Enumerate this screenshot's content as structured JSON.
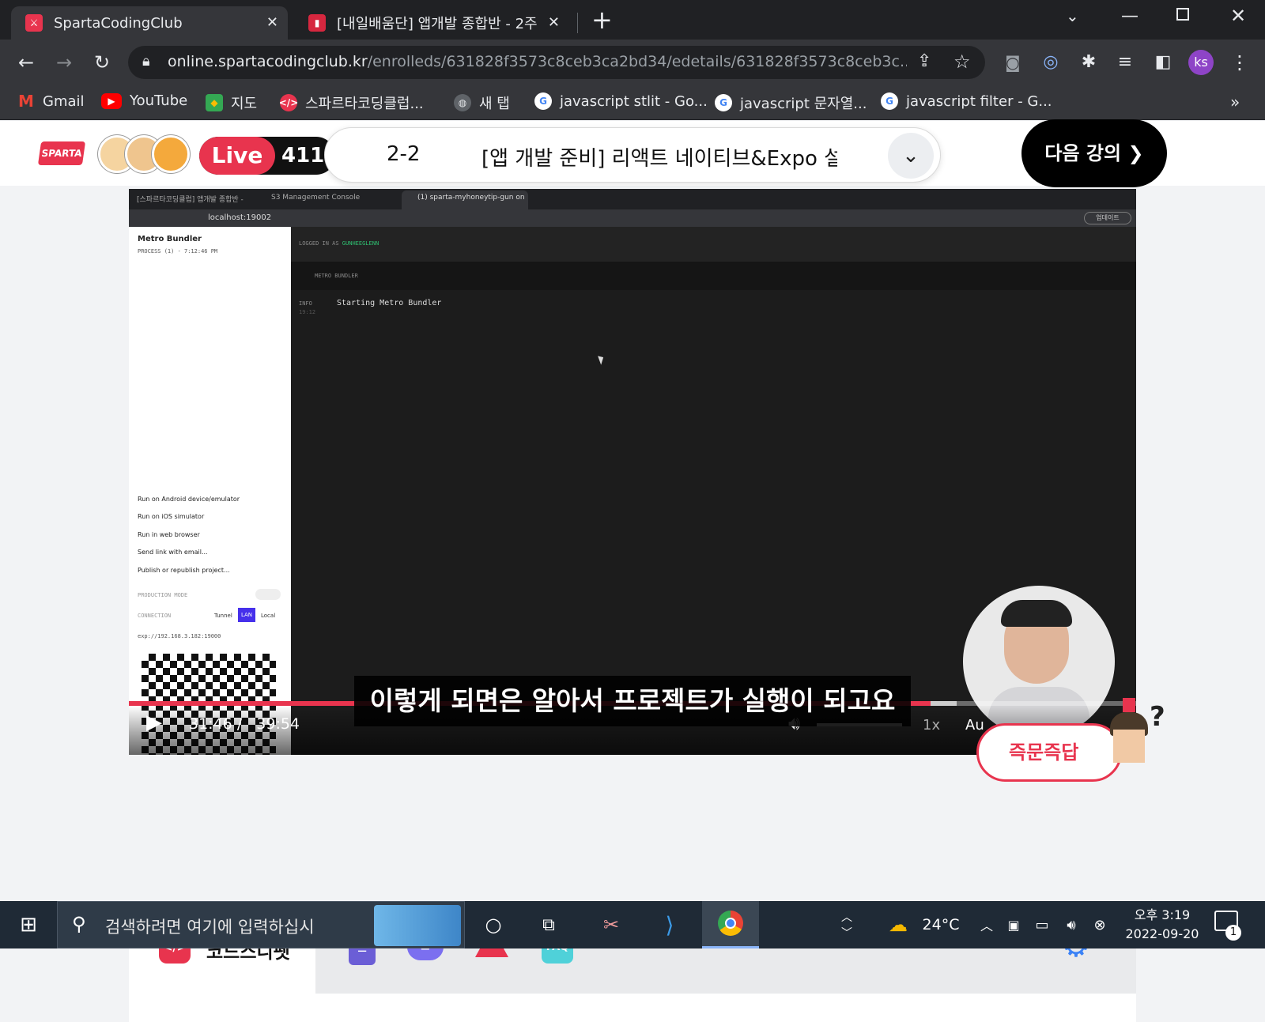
{
  "browser": {
    "tabs": [
      {
        "title": "SpartaCodingClub",
        "active": true
      },
      {
        "title": "[내일배움단] 앱개발 종합반 - 2주",
        "active": false
      }
    ],
    "url_host": "online.spartacodingclub.kr",
    "url_path": "/enrolleds/631828f3573c8ceb3ca2bd34/edetails/631828f3573c8ceb3c...",
    "profile_initials": "ks",
    "bookmarks": [
      {
        "label": "Gmail",
        "icon": "gmail-icon"
      },
      {
        "label": "YouTube",
        "icon": "youtube-icon"
      },
      {
        "label": "지도",
        "icon": "maps-icon"
      },
      {
        "label": "스파르타코딩클럽...",
        "icon": "sparta-icon"
      },
      {
        "label": "새 탭",
        "icon": "globe-icon"
      },
      {
        "label": "javascript stlit - Go...",
        "icon": "google-icon"
      },
      {
        "label": "javascript 문자열...",
        "icon": "google-icon"
      },
      {
        "label": "javascript filter - G...",
        "icon": "google-icon"
      }
    ],
    "bookmarks_overflow": "»"
  },
  "header": {
    "logo_text": "SPARTA",
    "live_label": "Live",
    "live_count": "411",
    "lesson_number": "2-2",
    "lesson_title": "[앱 개발 준비] 리액트 네이티브&Expo 설…",
    "next_button": "다음 강의"
  },
  "video": {
    "inner_tabs": [
      "[스파르타코딩클럽] 앱개발 종합반 -",
      "S3 Management Console",
      "(1) sparta-myhoneytip-gun on"
    ],
    "inner_url": "localhost:19002",
    "inner_update": "업데이트",
    "panel_title": "Metro Bundler",
    "panel_process": "PROCESS (1) - 7:12:46 PM",
    "logged_in": "LOGGED IN AS",
    "logged_user": "GUNHEEGLENN",
    "bundler_label": "METRO BUNDLER",
    "log_level": "INFO",
    "log_time": "19:12",
    "log_message": "Starting Metro Bundler",
    "menu": [
      "Run on Android device/emulator",
      "Run on iOS simulator",
      "Run in web browser",
      "Send link with email...",
      "Publish or republish project..."
    ],
    "production_mode": "PRODUCTION MODE",
    "connection": "CONNECTION",
    "conn_options": [
      "Tunnel",
      "LAN",
      "Local"
    ],
    "exp_url": "exp://192.168.3.182:19000",
    "subtitle": "이렇게 되면은 알아서 프로젝트가 실행이 되고요",
    "current_time": "31:46",
    "separator": "/",
    "duration": "39:54",
    "speed": "1x",
    "quality": "Au",
    "progress": 0.796,
    "buffered": 0.822,
    "volume": 1.0,
    "qa_button": "즉문즉답"
  },
  "panel": {
    "tabs": [
      {
        "label": "코드스니펫",
        "icon": "code-icon"
      },
      {
        "label": "",
        "icon": "checklist-icon"
      },
      {
        "label": "",
        "icon": "chat-icon"
      },
      {
        "label": "",
        "icon": "warning-icon"
      },
      {
        "label": "FAQ",
        "icon": "faq-icon"
      }
    ]
  },
  "taskbar": {
    "search_placeholder": "검색하려면 여기에 입력하십시",
    "weather": "24°C",
    "time": "오후 3:19",
    "date": "2022-09-20",
    "notification_count": "1"
  },
  "colors": {
    "brand_red": "#e8344e",
    "chrome_dark": "#202124",
    "chrome_mid": "#35363a",
    "lan_blue": "#4630eb"
  }
}
